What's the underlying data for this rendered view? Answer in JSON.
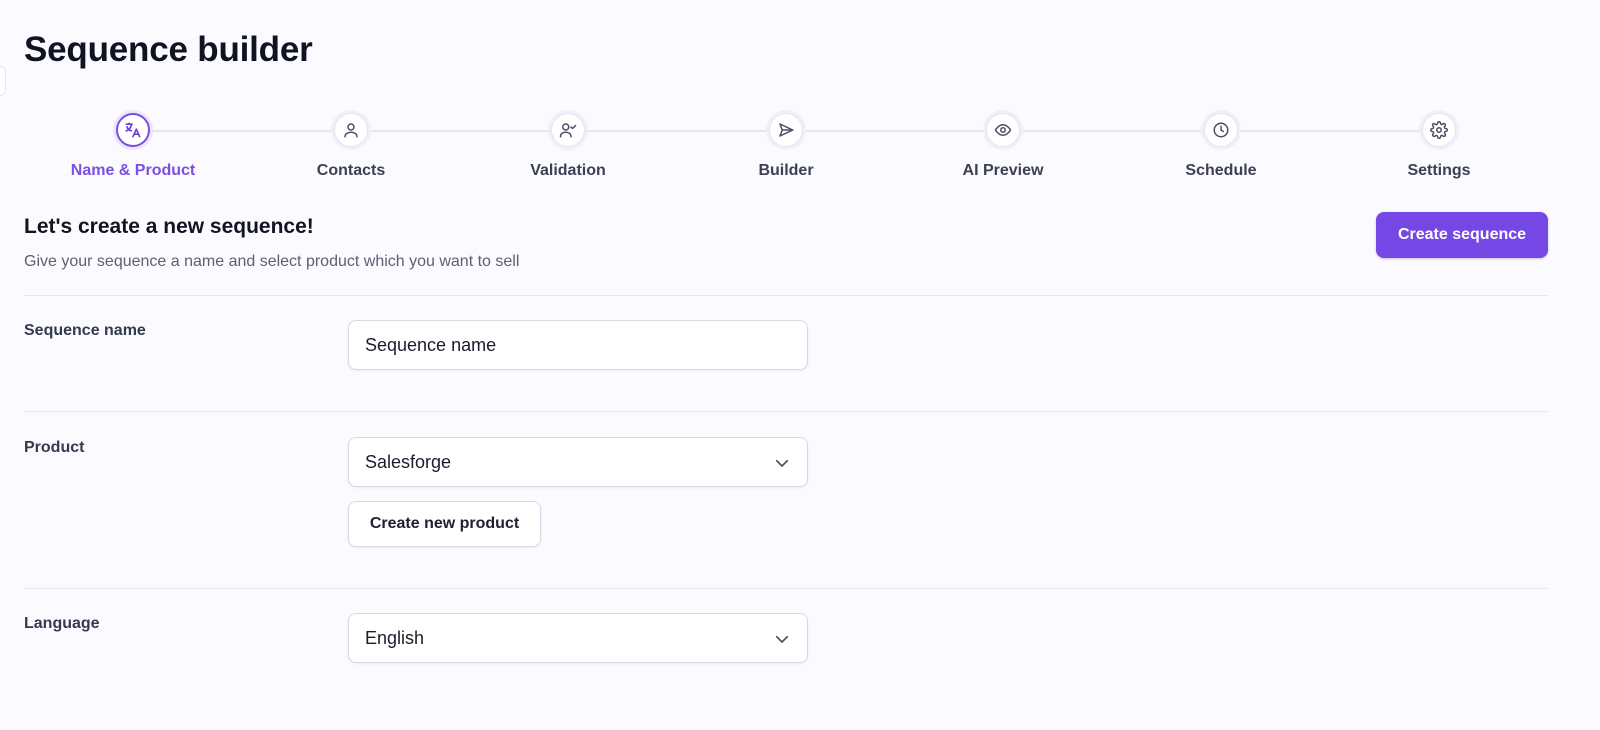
{
  "page": {
    "title": "Sequence builder"
  },
  "stepper": {
    "active_index": 0,
    "steps": [
      {
        "label": "Name & Product",
        "icon": "translate-icon"
      },
      {
        "label": "Contacts",
        "icon": "user-icon"
      },
      {
        "label": "Validation",
        "icon": "user-check-icon"
      },
      {
        "label": "Builder",
        "icon": "send-icon"
      },
      {
        "label": "AI Preview",
        "icon": "eye-icon"
      },
      {
        "label": "Schedule",
        "icon": "clock-icon"
      },
      {
        "label": "Settings",
        "icon": "gear-icon"
      }
    ]
  },
  "section": {
    "heading": "Let's create a new sequence!",
    "subtitle": "Give your sequence a name and select product which you want to sell",
    "create_button": "Create sequence"
  },
  "form": {
    "sequence_name": {
      "label": "Sequence name",
      "placeholder": "Sequence name",
      "value": ""
    },
    "product": {
      "label": "Product",
      "selected": "Salesforge",
      "create_button": "Create new product"
    },
    "language": {
      "label": "Language",
      "selected": "English"
    }
  },
  "colors": {
    "accent": "#7547e4",
    "active_step_text": "#7b4fe0",
    "background": "#fbfaff"
  }
}
